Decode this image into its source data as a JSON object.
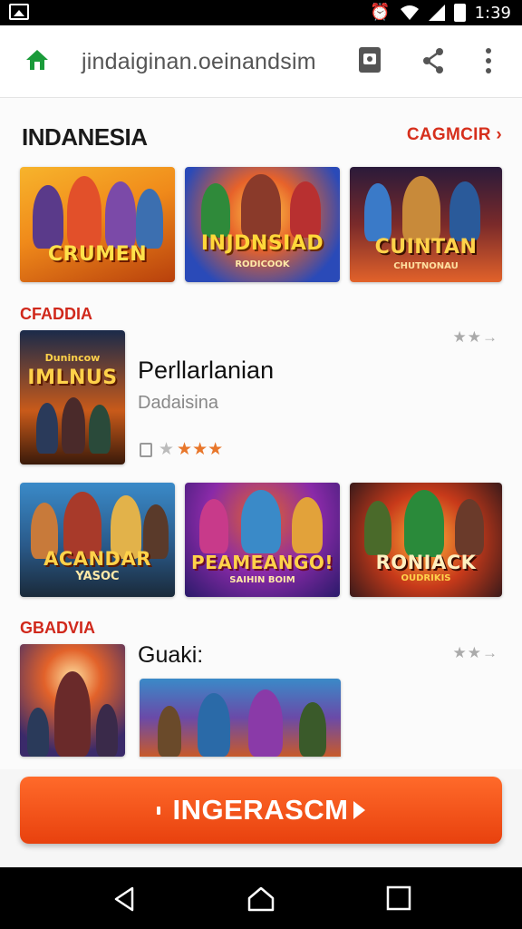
{
  "status_bar": {
    "time": "1:39",
    "icons": [
      "image-icon",
      "alarm-icon",
      "wifi-icon",
      "signal-icon",
      "battery-icon"
    ]
  },
  "browser": {
    "url": "jindaiginan.oeinandsim",
    "icons": [
      "home-icon",
      "tab-icon",
      "share-icon",
      "menu-icon"
    ]
  },
  "section1": {
    "title": "INDANESIA",
    "see_more": "CAGMCIR",
    "tiles": [
      {
        "label": "CRUMEN",
        "sub": ""
      },
      {
        "label": "INJDNSIAD",
        "sub": "RODICOOK"
      },
      {
        "label": "CUINTAN",
        "sub": "CHUTNONAU"
      }
    ]
  },
  "section2": {
    "title": "CFADDIA",
    "feature": {
      "thumb_label": "IMLNUS",
      "thumb_top": "Dunincow",
      "title": "Perllarlanian",
      "subtitle": "Dadaisina",
      "rating_stars": "★★★",
      "mini_rating": "★★→"
    },
    "tiles": [
      {
        "label": "ACANDAR",
        "sub": "YASOC"
      },
      {
        "label": "PEAMEANGO!",
        "sub": "SAIHIN BOIM"
      },
      {
        "label": "RONIACK",
        "sub": "OUDRIKIS"
      }
    ]
  },
  "section3": {
    "title": "GBADVIA",
    "feature": {
      "title": "Guaki:",
      "mini_rating": "★★→"
    }
  },
  "cta": {
    "label": "INGERASCM"
  },
  "colors": {
    "accent": "#e8410e",
    "section_red": "#d0281b",
    "home_green": "#1a9b3a"
  }
}
